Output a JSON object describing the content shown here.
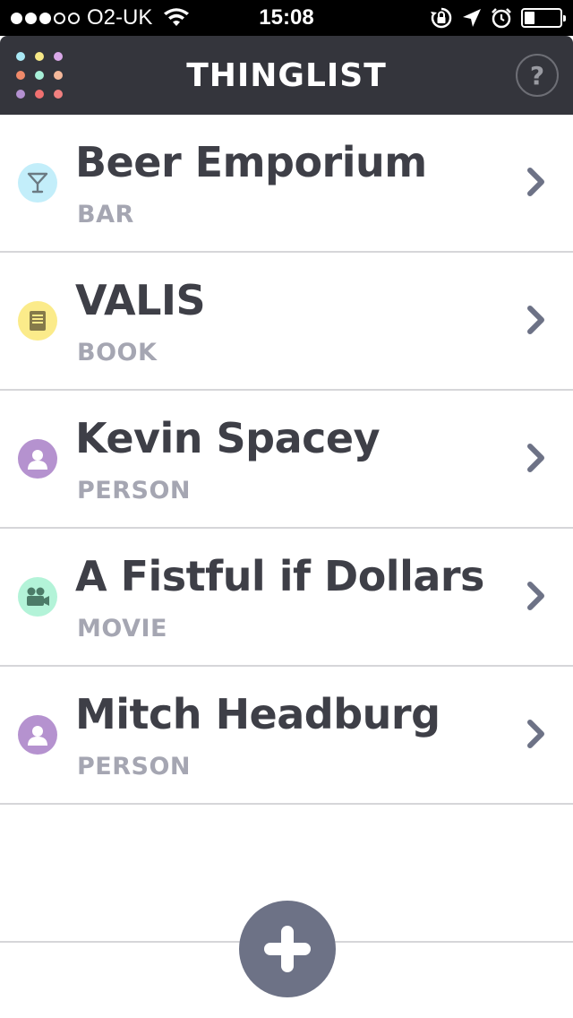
{
  "status_bar": {
    "carrier": "O2-UK",
    "time": "15:08",
    "signal_bars_filled": 3,
    "signal_bars_total": 5,
    "battery_level": 0.3,
    "icons": [
      "wifi-icon",
      "rotation-lock-icon",
      "location-icon",
      "alarm-icon",
      "battery-icon"
    ]
  },
  "header": {
    "title": "THINGLIST",
    "help_label": "?",
    "menu_dot_colors": [
      "#a9e8f5",
      "#f6e887",
      "#d9a8e8",
      "#f08a6a",
      "#a8f0d8",
      "#f5b89a",
      "#b390d0",
      "#f07070",
      "#f08080"
    ]
  },
  "items": [
    {
      "title": "Beer Emporium",
      "type": "BAR",
      "icon": "cocktail-icon",
      "icon_color": "#c3eefa",
      "icon_fg": "#6b7a82"
    },
    {
      "title": "VALIS",
      "type": "BOOK",
      "icon": "book-icon",
      "icon_color": "#fbeb8a",
      "icon_fg": "#857a4a"
    },
    {
      "title": "Kevin Spacey",
      "type": "PERSON",
      "icon": "person-icon",
      "icon_color": "#b592cf",
      "icon_fg": "#ffffff"
    },
    {
      "title": "A Fistful if Dollars",
      "type": "MOVIE",
      "icon": "movie-camera-icon",
      "icon_color": "#b3f3d8",
      "icon_fg": "#4c7b68"
    },
    {
      "title": "Mitch Headburg",
      "type": "PERSON",
      "icon": "person-icon",
      "icon_color": "#b592cf",
      "icon_fg": "#ffffff"
    }
  ],
  "add_button": {
    "label": "+",
    "icon": "plus-icon"
  },
  "colors": {
    "header_bg": "#34353c",
    "title_text": "#3e3f47",
    "type_text": "#a5a6b2",
    "chevron": "#6d7286",
    "add_button": "#6d7286"
  }
}
